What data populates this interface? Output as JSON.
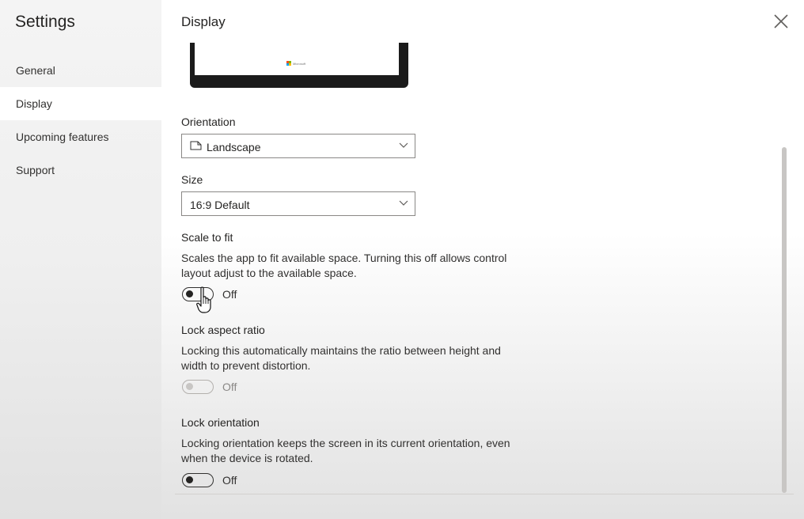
{
  "sidebar": {
    "title": "Settings",
    "items": [
      {
        "label": "General",
        "selected": false
      },
      {
        "label": "Display",
        "selected": true
      },
      {
        "label": "Upcoming features",
        "selected": false
      },
      {
        "label": "Support",
        "selected": false
      }
    ]
  },
  "main": {
    "title": "Display",
    "preview": {
      "logo_text": "Microsoft"
    },
    "orientation": {
      "label": "Orientation",
      "value": "Landscape",
      "icon": "page-landscape-icon"
    },
    "size": {
      "label": "Size",
      "value": "16:9 Default"
    },
    "scale_to_fit": {
      "label": "Scale to fit",
      "description": "Scales the app to fit available space. Turning this off allows control layout adjust to the available space.",
      "state": "Off",
      "enabled": true
    },
    "lock_aspect_ratio": {
      "label": "Lock aspect ratio",
      "description": "Locking this automatically maintains the ratio between height and width to prevent distortion.",
      "state": "Off",
      "enabled": false
    },
    "lock_orientation": {
      "label": "Lock orientation",
      "description": "Locking orientation keeps the screen in its current orientation, even when the device is rotated.",
      "state": "Off",
      "enabled": true
    }
  },
  "colors": {
    "sidebar_bg": "#f4f4f4",
    "selected_bg": "#ffffff",
    "text": "#252423",
    "disabled": "#c8c6c4"
  }
}
